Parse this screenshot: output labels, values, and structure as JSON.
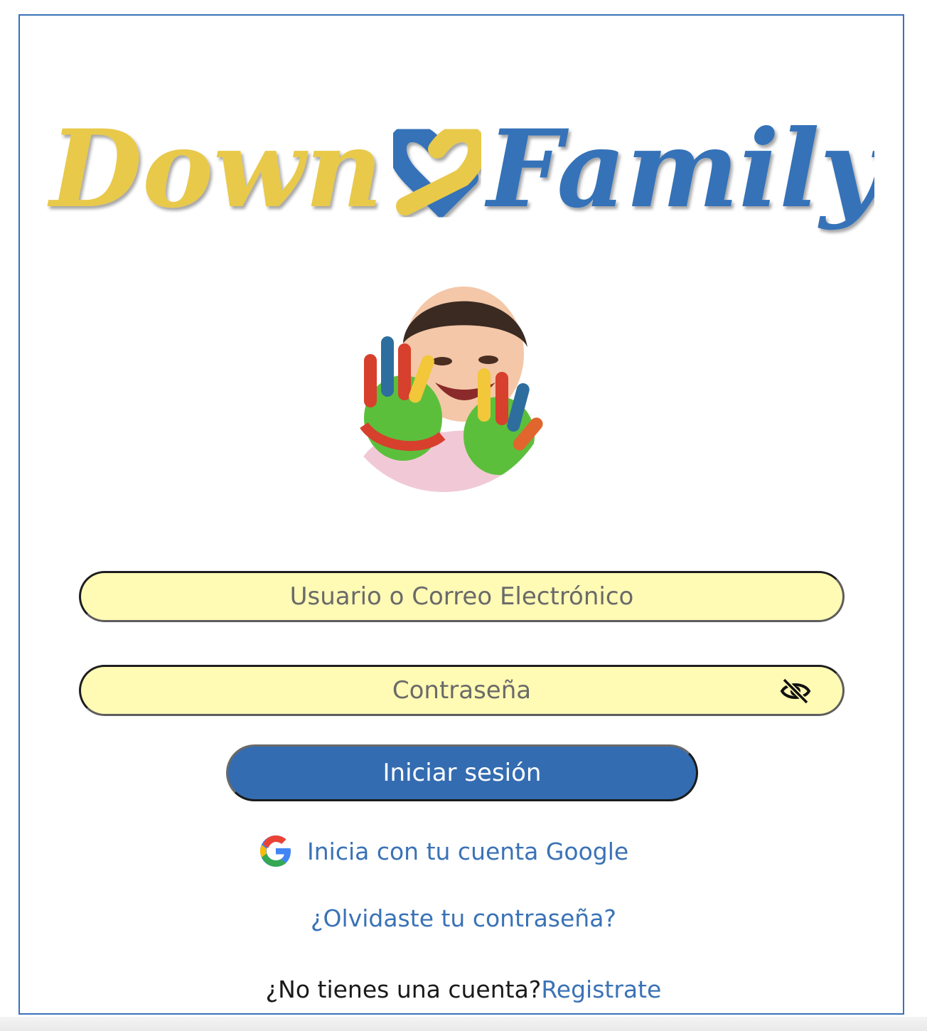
{
  "logo": {
    "word_left": "Down",
    "word_right": "Family",
    "colors": {
      "yellow": "#e8c94a",
      "blue": "#3472b8"
    }
  },
  "avatar": {
    "icon": "child-painted-hands-photo"
  },
  "login_form": {
    "username_placeholder": "Usuario o Correo Electrónico",
    "password_placeholder": "Contraseña",
    "password_toggle_icon": "eye-slash-icon",
    "submit_label": "Iniciar sesión"
  },
  "google": {
    "icon": "google-g-icon",
    "label": "Inicia con tu cuenta Google"
  },
  "forgot": {
    "label": "¿Olvidaste tu contraseña?"
  },
  "register": {
    "prompt": "¿No tienes una cuenta?",
    "link_label": "Registrate"
  },
  "theme": {
    "field_bg": "#fffab4",
    "button_bg": "#346cb1",
    "link_color": "#3a72b6",
    "frame_border": "#3a73b8"
  }
}
